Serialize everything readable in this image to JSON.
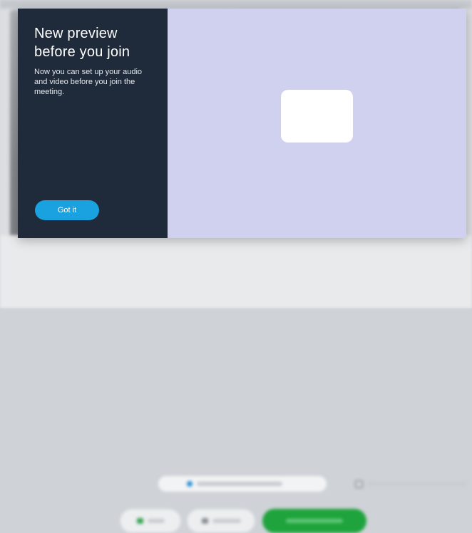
{
  "dialog": {
    "title": "New preview before you join",
    "body": "Now you can set up your audio and video before you join the meeting.",
    "got_it_label": "Got it"
  },
  "colors": {
    "panel": "#1f2a3a",
    "accent": "#1aa1e0",
    "preview_bg": "#d0d1ee",
    "join_green": "#1fa33c"
  },
  "icons": {
    "preview_placeholder": "blank-video-card"
  }
}
